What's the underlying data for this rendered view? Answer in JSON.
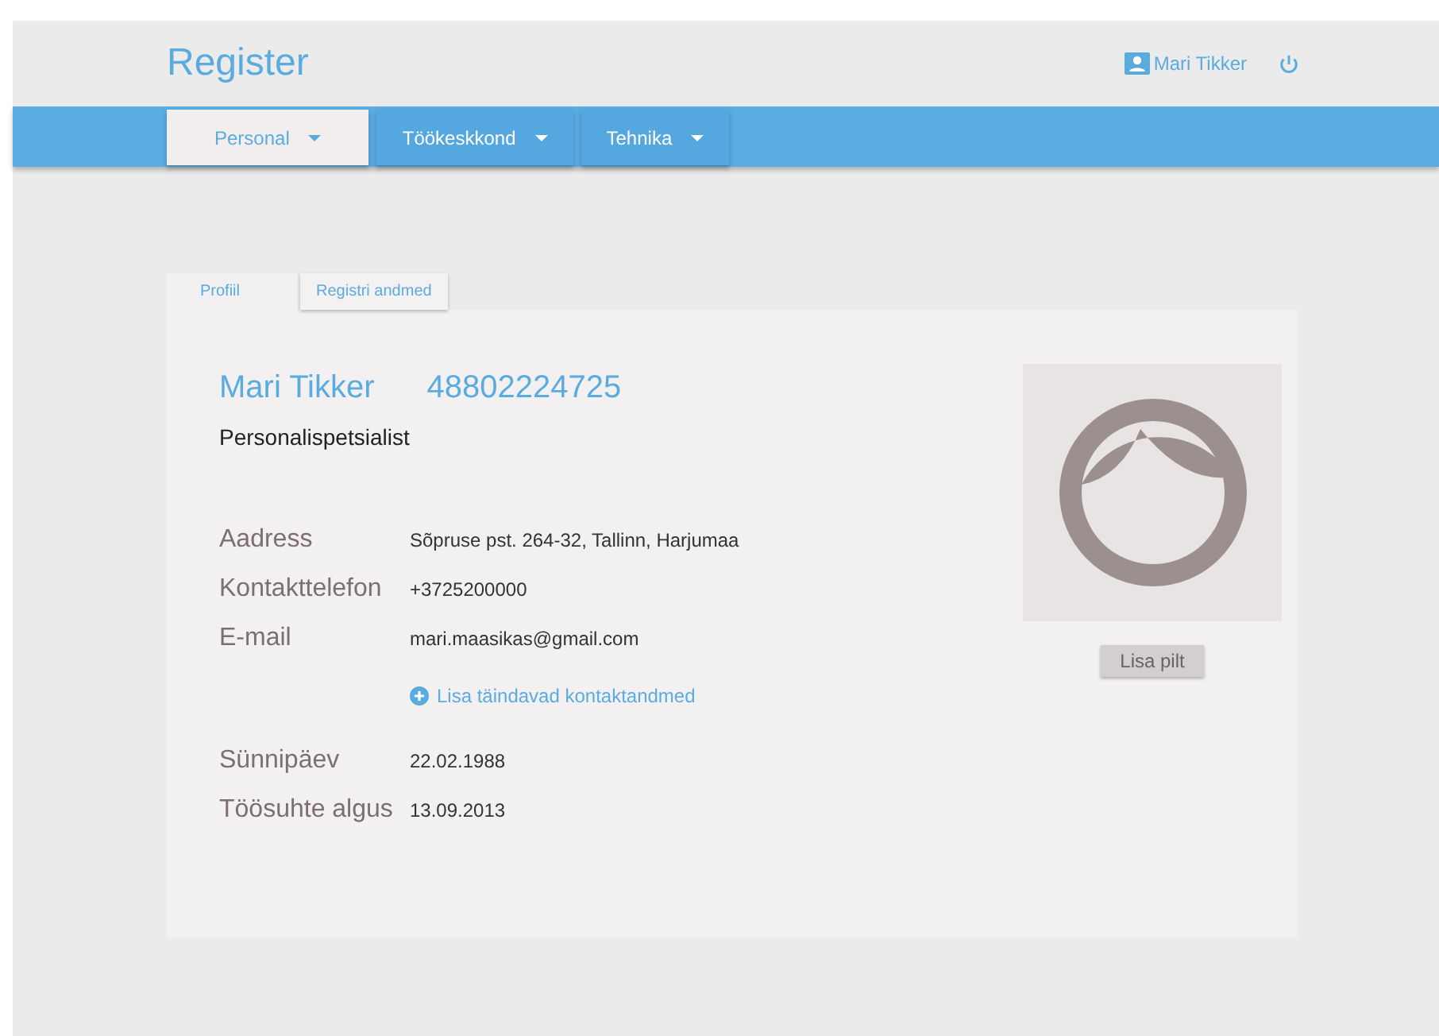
{
  "header": {
    "title": "Register",
    "user": "Mari Tikker"
  },
  "nav": [
    {
      "label": "Personal",
      "selected": true
    },
    {
      "label": "Töökeskkond",
      "selected": false
    },
    {
      "label": "Tehnika",
      "selected": false
    }
  ],
  "tabs": [
    {
      "label": "Profiil",
      "selected": true
    },
    {
      "label": "Registri andmed",
      "selected": false
    }
  ],
  "profile": {
    "name": "Mari Tikker",
    "id_code": "48802224725",
    "position": "Personalispetsialist"
  },
  "contact": [
    {
      "label": "Aadress",
      "value": "Sõpruse pst. 264-32, Tallinn, Harjumaa"
    },
    {
      "label": "Kontakttelefon",
      "value": "+3725200000"
    },
    {
      "label": "E-mail",
      "value": "mari.maasikas@gmail.com"
    }
  ],
  "add_link": "Lisa täindavad kontaktandmed",
  "dates": [
    {
      "label": "Sünnipäev",
      "value": "22.02.1988"
    },
    {
      "label": "Töösuhte algus",
      "value": "13.09.2013"
    }
  ],
  "photo_button": "Lisa pilt"
}
